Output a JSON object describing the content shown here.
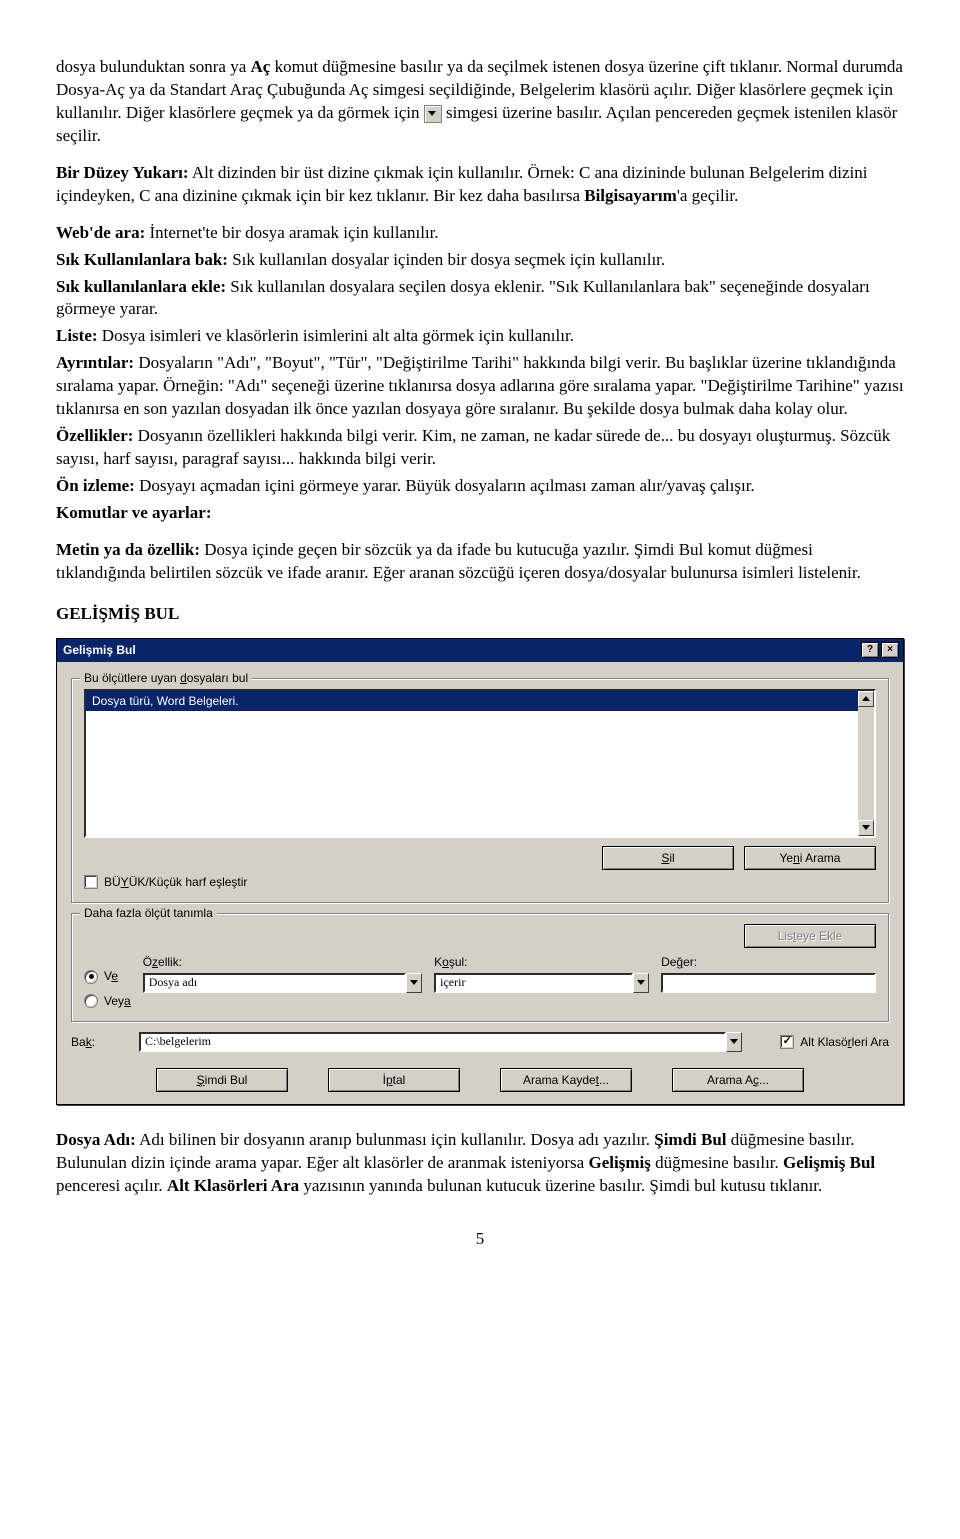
{
  "para": {
    "p1a": "dosya bulunduktan sonra ya ",
    "p1b": "Aç",
    "p1c": " komut düğmesine basılır ya da seçilmek istenen dosya üzerine çift tıklanır. Normal durumda Dosya-Aç ya da Standart Araç Çubuğunda Aç simgesi seçildiğinde, Belgelerim klasörü açılır. Diğer klasörlere geçmek için kullanılır. Diğer klasörlere geçmek ya da görmek  için  ",
    "p1d": "   simgesi üzerine basılır. Açılan pencereden geçmek istenilen klasör seçilir.",
    "bdy_h": "Bir Düzey Yukarı:",
    "bdy_t": " Alt dizinden bir üst dizine çıkmak için kullanılır. Örnek: C ana dizininde bulunan Belgelerim dizini içindeyken, C ana dizinine çıkmak için bir kez tıklanır. Bir kez daha basılırsa ",
    "bdy_t2": "Bilgisayarım",
    "bdy_t3": "'a geçilir.",
    "web_h": "Web'de ara:",
    "web_t": " İnternet'te bir dosya aramak için kullanılır.",
    "skb_h": "Sık Kullanılanlara bak:",
    "skb_t": " Sık kullanılan dosyalar içinden bir dosya seçmek için kullanılır.",
    "ske_h": "Sık kullanılanlara ekle:",
    "ske_t": " Sık kullanılan dosyalara seçilen dosya eklenir. \"Sık Kullanılanlara bak\" seçeneğinde dosyaları görmeye yarar.",
    "lst_h": "Liste:",
    "lst_t": " Dosya isimleri ve klasörlerin isimlerini alt alta görmek için kullanılır.",
    "ayr_h": "Ayrıntılar:",
    "ayr_t": " Dosyaların \"Adı\", \"Boyut\", \"Tür\", \"Değiştirilme Tarihi\" hakkında bilgi verir. Bu başlıklar üzerine tıklandığında sıralama yapar. Örneğin: \"Adı\" seçeneği üzerine tıklanırsa dosya adlarına göre sıralama yapar. \"Değiştirilme Tarihine\" yazısı tıklanırsa en son yazılan dosyadan ilk önce yazılan dosyaya göre sıralanır. Bu şekilde dosya bulmak daha kolay olur.",
    "oz_h": "Özellikler:",
    "oz_t": " Dosyanın özellikleri hakkında bilgi verir. Kim, ne zaman, ne kadar sürede de... bu dosyayı oluşturmuş. Sözcük sayısı, harf sayısı, paragraf sayısı... hakkında bilgi verir.",
    "oni_h": "Ön izleme:",
    "oni_t": " Dosyayı açmadan içini görmeye yarar. Büyük dosyaların açılması zaman alır/yavaş çalışır.",
    "kom_h": "Komutlar ve ayarlar:",
    "met_h": "Metin ya da özellik:",
    "met_t": "  Dosya içinde geçen bir sözcük ya da ifade bu kutucuğa yazılır. Şimdi Bul komut düğmesi tıklandığında belirtilen sözcük ve ifade aranır. Eğer aranan sözcüğü içeren dosya/dosyalar bulunursa isimleri listelenir.",
    "heading": "GELİŞMİŞ BUL",
    "dosya_h": "Dosya Adı:",
    "dosya_t1": " Adı bilinen bir dosyanın aranıp bulunması için kullanılır. Dosya adı yazılır. ",
    "dosya_t2": "Şimdi Bul",
    "dosya_t3": " düğmesine basılır. Bulunulan dizin içinde arama yapar. Eğer alt klasörler de aranmak isteniyorsa ",
    "dosya_t4": "Gelişmiş",
    "dosya_t5": " düğmesine basılır. ",
    "dosya_t6": "Gelişmiş Bul",
    "dosya_t7": " penceresi açılır. ",
    "dosya_t8": "Alt Klasörleri Ara",
    "dosya_t9": " yazısının yanında bulunan kutucuk üzerine basılır. Şimdi bul kutusu tıklanır.",
    "pagenum": "5"
  },
  "dialog": {
    "title": "Gelişmiş Bul",
    "help": "?",
    "close": "×",
    "group1": "Bu ölçütlere uyan dosyaları bul",
    "list_row": "Dosya türü, Word Belgeleri.",
    "sil": "Sil",
    "yeni": "Yeni Arama",
    "case": "BÜYÜK/Küçük harf eşleştir",
    "group2": "Daha fazla ölçüt tanımla",
    "listeye": "Listeye Ekle",
    "ve": "Ve",
    "veya": "Veya",
    "ozellik_l": "Özellik:",
    "ozellik_v": "Dosya adı",
    "kosul_l": "Koşul:",
    "kosul_v": "içerir",
    "deger_l": "Değer:",
    "deger_v": "",
    "bak_l": "Bak:",
    "bak_v": "C:\\belgelerim",
    "alt": "Alt Klasörleri Ara",
    "simdi": "Şimdi Bul",
    "iptal": "İptal",
    "kaydet": "Arama Kaydet...",
    "ac": "Arama Aç..."
  }
}
